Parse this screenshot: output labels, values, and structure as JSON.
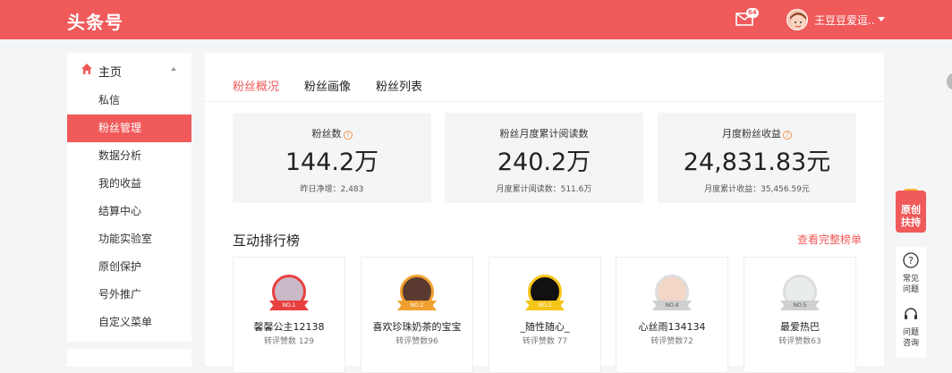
{
  "header": {
    "logo": "头条号",
    "mail_badge": "64",
    "username": "王豆豆爱逗..",
    "accent_color": "#f05a5a"
  },
  "sidebar": {
    "home_label": "主页",
    "items": [
      {
        "label": "私信",
        "active": false
      },
      {
        "label": "粉丝管理",
        "active": true
      },
      {
        "label": "数据分析",
        "active": false
      },
      {
        "label": "我的收益",
        "active": false
      },
      {
        "label": "结算中心",
        "active": false
      },
      {
        "label": "功能实验室",
        "active": false
      },
      {
        "label": "原创保护",
        "active": false
      },
      {
        "label": "号外推广",
        "active": false
      },
      {
        "label": "自定义菜单",
        "active": false
      }
    ]
  },
  "tabs": [
    {
      "label": "粉丝概况",
      "active": true
    },
    {
      "label": "粉丝画像",
      "active": false
    },
    {
      "label": "粉丝列表",
      "active": false
    }
  ],
  "stats": [
    {
      "label": "粉丝数",
      "has_help": true,
      "value": "144.2万",
      "sub": "昨日净增：2,483"
    },
    {
      "label": "粉丝月度累计阅读数",
      "has_help": false,
      "value": "240.2万",
      "sub": "月度累计阅读数：511.6万"
    },
    {
      "label": "月度粉丝收益",
      "has_help": true,
      "value": "24,831.83元",
      "sub": "月度累计收益：35,456.59元"
    }
  ],
  "ranking": {
    "title": "互动排行榜",
    "more_link": "查看完整榜单",
    "cards": [
      {
        "rank": "NO.1",
        "name": "馨馨公主12138",
        "score": "转评赞数 129",
        "medal_color": "#e84040"
      },
      {
        "rank": "NO.2",
        "name": "喜欢珍珠奶茶的宝宝",
        "score": "转评赞数96",
        "medal_color": "#f0a030"
      },
      {
        "rank": "NO.3",
        "name": "_随性随心_",
        "score": "转评赞数 77",
        "medal_color": "#f5c518"
      },
      {
        "rank": "NO.4",
        "name": "心丝雨134134",
        "score": "转评赞数72",
        "medal_color": "#cfcfcf"
      },
      {
        "rank": "NO.5",
        "name": "最爱热巴",
        "score": "转评赞数63",
        "medal_color": "#cfcfcf"
      }
    ]
  },
  "float": {
    "original_label_1": "原创",
    "original_label_2": "扶持",
    "faq_1": "常见",
    "faq_2": "问题",
    "consult_1": "问题",
    "consult_2": "咨询"
  }
}
